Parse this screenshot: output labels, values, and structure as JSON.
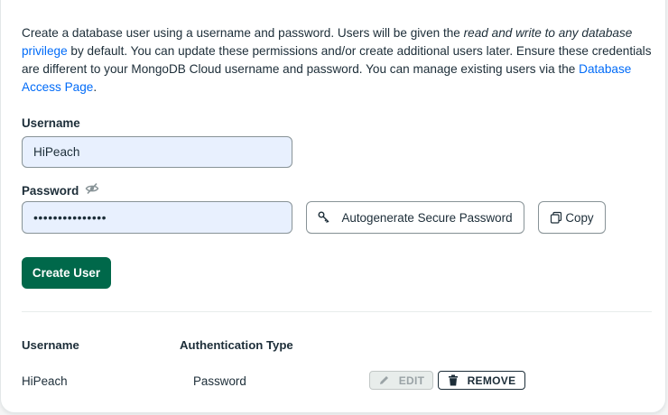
{
  "description": {
    "part1": "Create a database user using a username and password. Users will be given the ",
    "emphasis": "read and write to any database",
    "link1": "privilege",
    "part2": " by default. You can update these permissions and/or create additional users later. Ensure these credentials are different to your MongoDB Cloud username and password. You can manage existing users via the ",
    "link2": "Database Access Page",
    "part3": "."
  },
  "form": {
    "username_label": "Username",
    "username_value": "HiPeach",
    "password_label": "Password",
    "password_value": "•••••••••••••••",
    "autogenerate_label": "Autogenerate Secure Password",
    "copy_label": "Copy",
    "create_label": "Create User"
  },
  "table": {
    "headers": [
      "Username",
      "Authentication Type"
    ],
    "rows": [
      {
        "username": "HiPeach",
        "auth_type": "Password",
        "edit_label": "EDIT",
        "remove_label": "REMOVE"
      }
    ]
  },
  "icons": {
    "password_visibility": "eye-slash-icon",
    "autogenerate": "key-icon",
    "copy": "copy-icon",
    "edit": "pencil-icon",
    "remove": "trash-icon"
  },
  "colors": {
    "primary": "#00684a",
    "link": "#016bf8",
    "input_bg": "#e8f0fe"
  }
}
